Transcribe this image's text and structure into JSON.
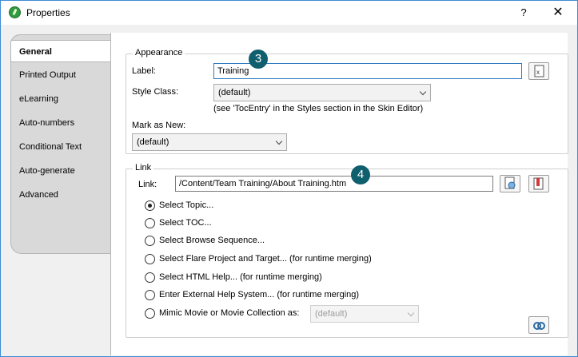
{
  "window": {
    "title": "Properties",
    "help_label": "?",
    "close_label": "✕"
  },
  "tabs": {
    "active": "General",
    "items": [
      "Printed Output",
      "eLearning",
      "Auto-numbers",
      "Conditional Text",
      "Auto-generate",
      "Advanced"
    ]
  },
  "appearance": {
    "legend": "Appearance",
    "label_caption": "Label:",
    "label_value": "Training",
    "style_class_caption": "Style Class:",
    "style_class_value": "(default)",
    "style_hint": "(see 'TocEntry' in the Styles section in the Skin Editor)",
    "mark_new_caption": "Mark as New:",
    "mark_new_value": "(default)"
  },
  "link": {
    "legend": "Link",
    "link_caption": "Link:",
    "link_value": "/Content/Team Training/About Training.htm",
    "options": [
      {
        "label": "Select Topic...",
        "checked": true
      },
      {
        "label": "Select TOC...",
        "checked": false
      },
      {
        "label": "Select Browse Sequence...",
        "checked": false
      },
      {
        "label": "Select Flare Project and Target... (for runtime merging)",
        "checked": false
      },
      {
        "label": "Select HTML Help... (for runtime merging)",
        "checked": false
      },
      {
        "label": "Enter External Help System... (for runtime merging)",
        "checked": false
      },
      {
        "label": "Mimic Movie or Movie Collection as:",
        "checked": false
      }
    ],
    "mimic_select_value": "(default)"
  },
  "callouts": {
    "badge_1": "3",
    "badge_2": "4"
  },
  "colors": {
    "titlebar_border": "#3c8bd6",
    "badge": "#0f5f6e",
    "app_icon": "#2f9a3e"
  }
}
